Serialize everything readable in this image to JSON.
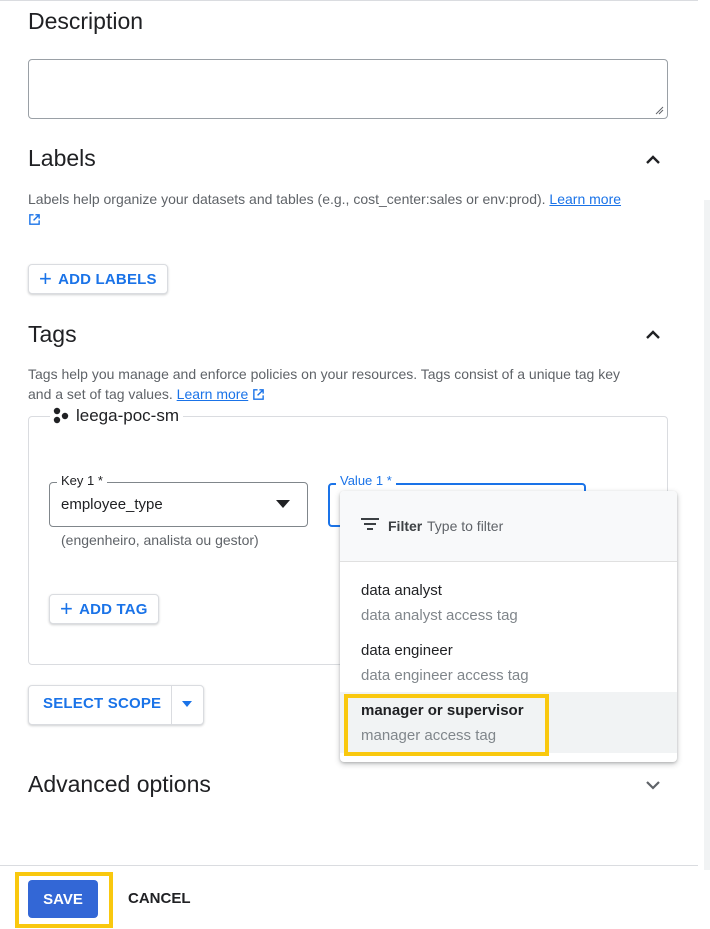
{
  "description": {
    "heading": "Description",
    "value": ""
  },
  "labels": {
    "heading": "Labels",
    "help_text": "Labels help organize your datasets and tables (e.g., cost_center:sales or env:prod).",
    "learn_more": "Learn more",
    "add_button": "ADD LABELS"
  },
  "tags": {
    "heading": "Tags",
    "help_line1": "Tags help you manage and enforce policies on your resources. Tags consist of a unique tag key",
    "help_line2": "and a set of tag values.",
    "learn_more": "Learn more",
    "project": "leega-poc-sm",
    "key_label": "Key 1 *",
    "key_value": "employee_type",
    "key_hint": "(engenheiro, analista ou gestor)",
    "value_label": "Value 1 *",
    "add_tag_button": "ADD TAG"
  },
  "scope": {
    "button": "SELECT SCOPE"
  },
  "dropdown": {
    "filter_label": "Filter",
    "filter_placeholder": "Type to filter",
    "options": [
      {
        "title": "data analyst",
        "subtitle": "data analyst access tag"
      },
      {
        "title": "data engineer",
        "subtitle": "data engineer access tag"
      },
      {
        "title": "manager or supervisor",
        "subtitle": "manager access tag"
      }
    ]
  },
  "advanced": {
    "heading": "Advanced options"
  },
  "footer": {
    "save": "SAVE",
    "cancel": "CANCEL"
  },
  "colors": {
    "accent": "#1a73e8",
    "save_button": "#3367d6",
    "highlight": "#f9c80e"
  }
}
